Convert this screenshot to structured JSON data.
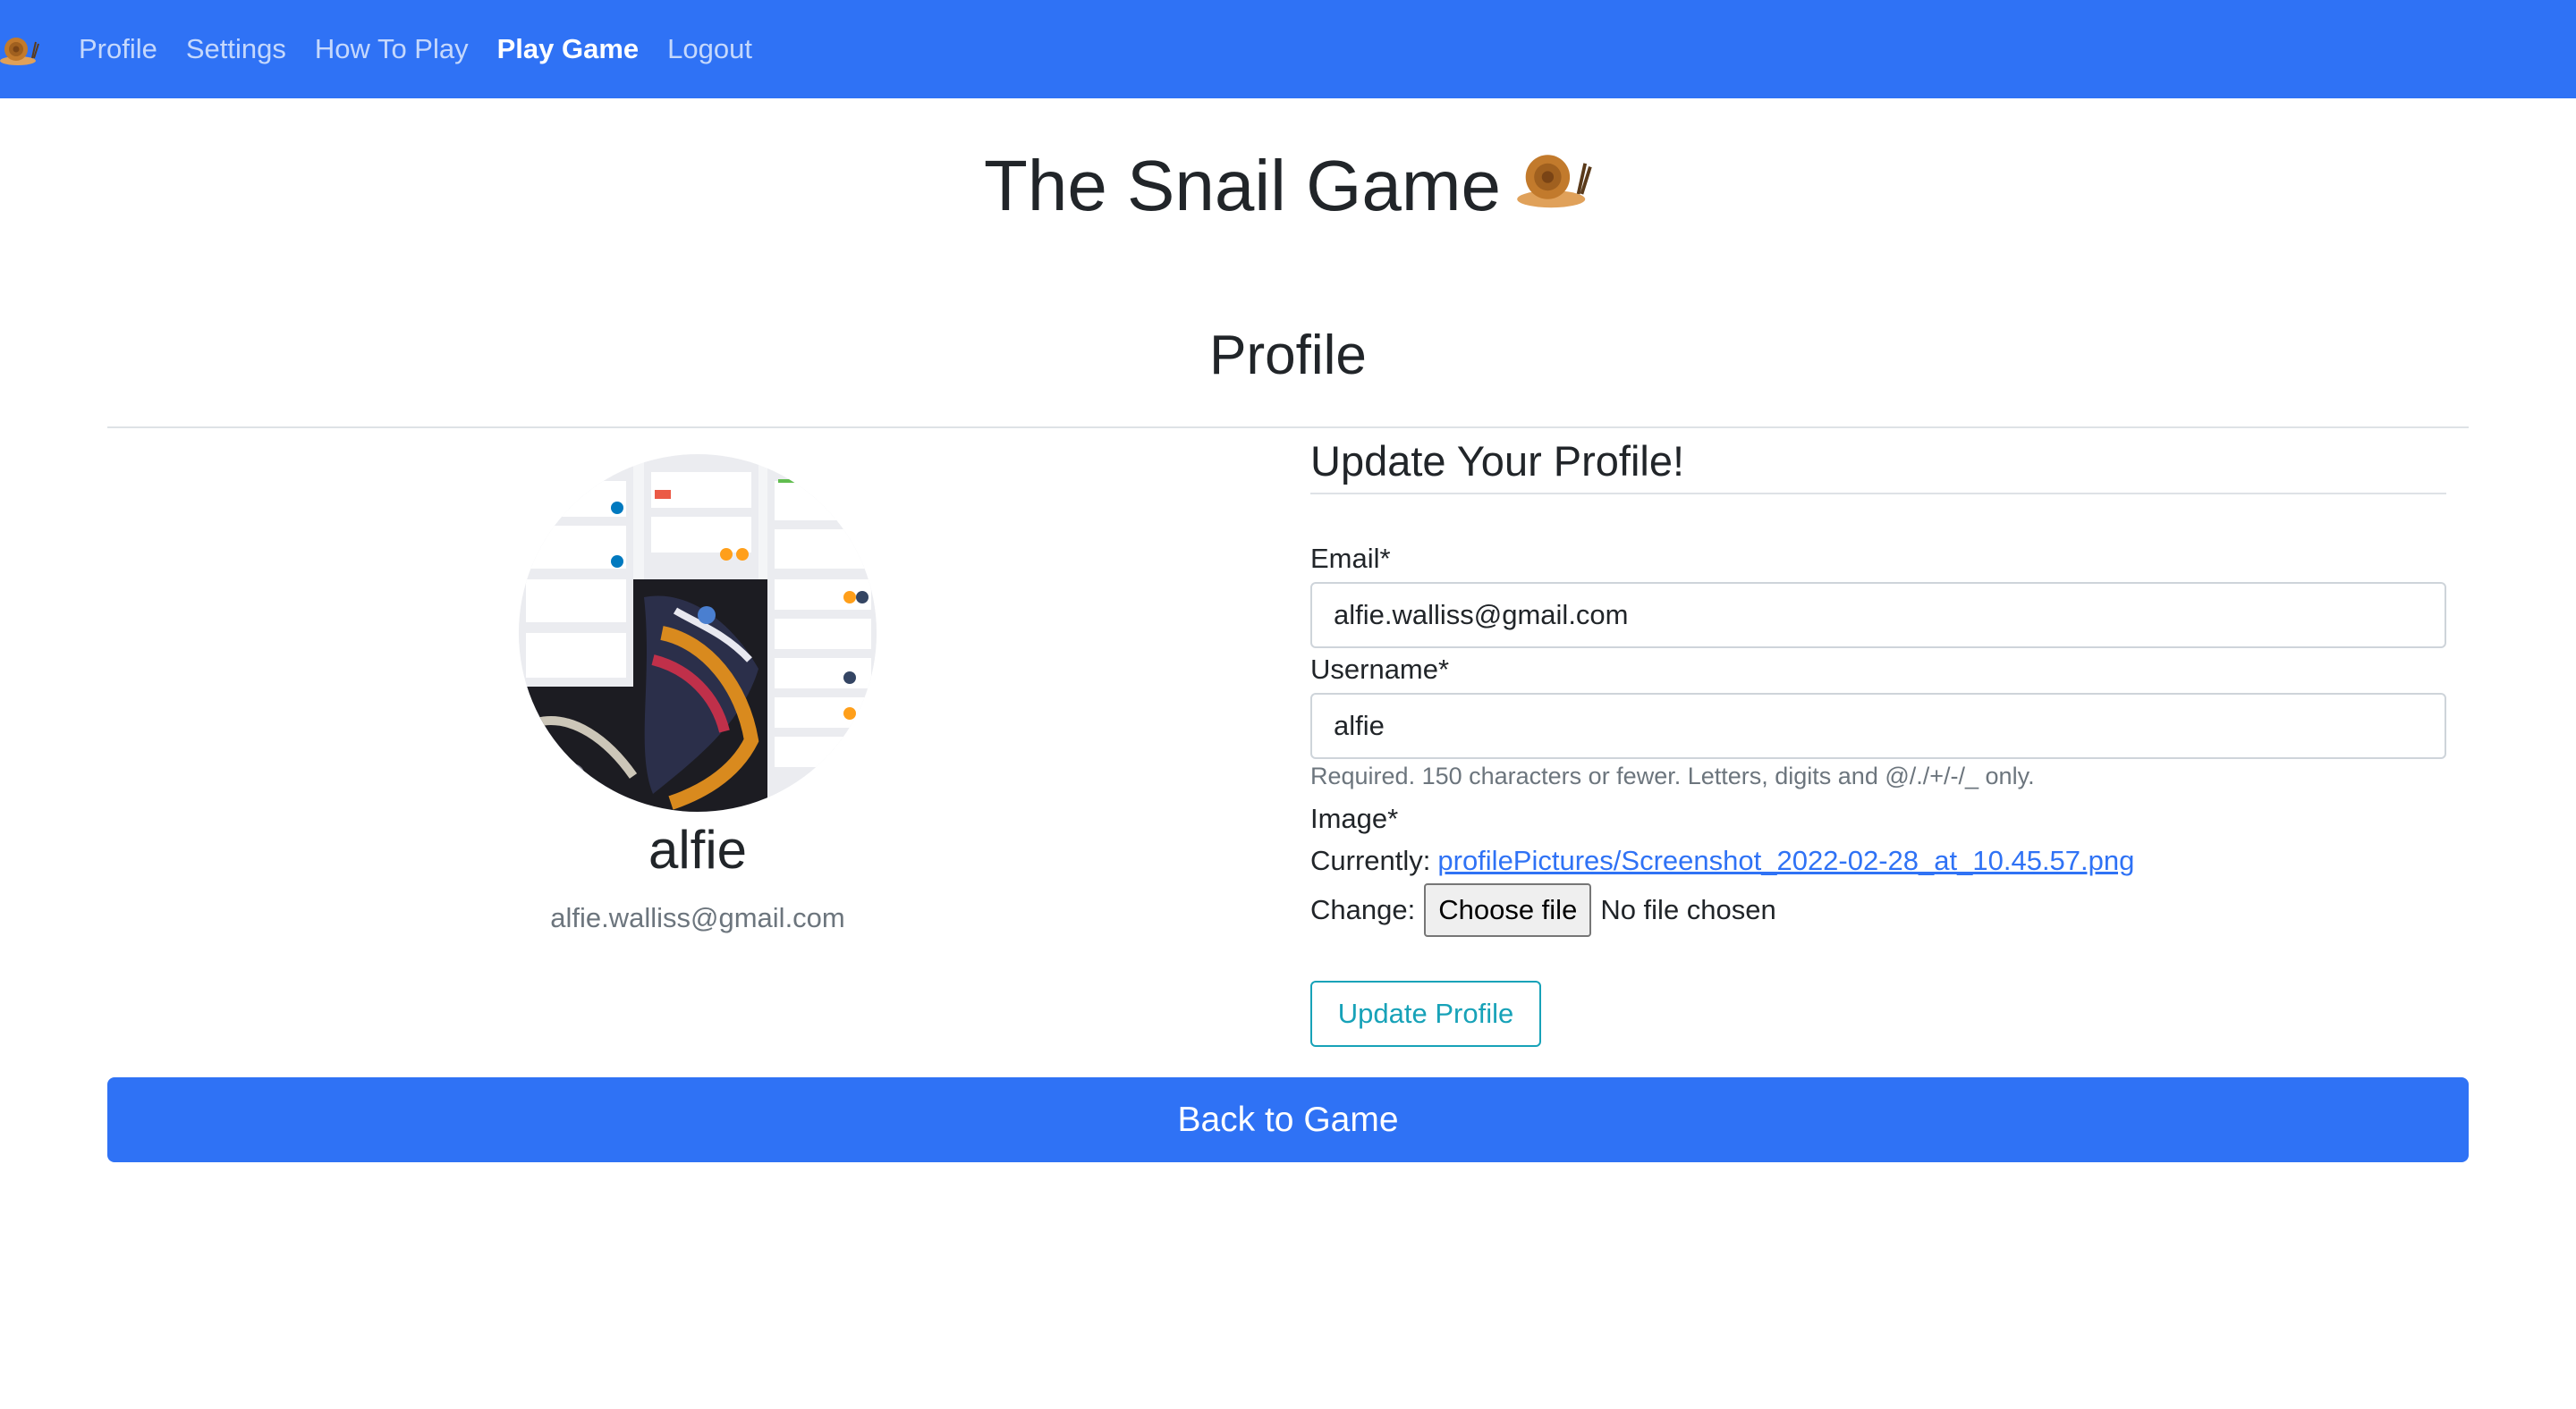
{
  "nav": {
    "brand_icon": "snail-icon",
    "items": [
      {
        "label": "Profile",
        "active": false
      },
      {
        "label": "Settings",
        "active": false
      },
      {
        "label": "How To Play",
        "active": false
      },
      {
        "label": "Play Game",
        "active": true
      },
      {
        "label": "Logout",
        "active": false
      }
    ]
  },
  "site_title": "The Snail Game",
  "page_title": "Profile",
  "user": {
    "username": "alfie",
    "email": "alfie.walliss@gmail.com"
  },
  "form": {
    "title": "Update Your Profile!",
    "email_label": "Email*",
    "email_value": "alfie.walliss@gmail.com",
    "username_label": "Username*",
    "username_value": "alfie",
    "username_help": "Required. 150 characters or fewer. Letters, digits and @/./+/-/_ only.",
    "image_label": "Image*",
    "currently_label": "Currently:",
    "current_image": "profilePictures/Screenshot_2022-02-28_at_10.45.57.png",
    "change_label": "Change:",
    "choose_file": "Choose file",
    "no_file": "No file chosen",
    "submit_label": "Update Profile"
  },
  "back_label": "Back to Game",
  "colors": {
    "primary": "#2f72f5",
    "info": "#17a2b8",
    "muted": "#6c757d"
  }
}
